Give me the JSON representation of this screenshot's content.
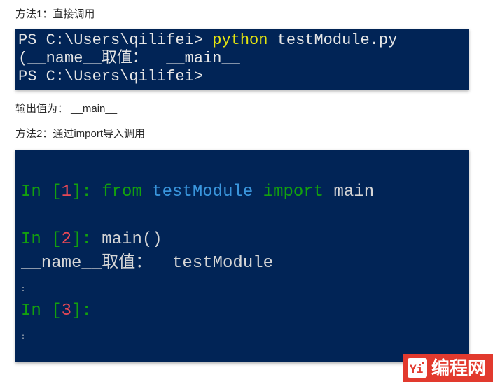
{
  "method1_title": "方法1：直接调用",
  "term1": {
    "line1_prompt": "PS C:\\Users\\qilifei> ",
    "line1_cmd": "python",
    "line1_arg": " testModule.py",
    "line2_pre": "(",
    "line2_label": "__name__取值：  ",
    "line2_value": "__main__",
    "line3_prompt": "PS C:\\Users\\qilifei>"
  },
  "output_label": "输出值为：  ",
  "output_value": "__main__",
  "method2_title": "方法2：通过import导入调用",
  "term2": {
    "in1_prefix": "In [",
    "in1_num": "1",
    "in1_suffix": "]: ",
    "in1_from": "from",
    "in1_module": " testModule ",
    "in1_import": "import",
    "in1_name": " main",
    "in2_prefix": "In [",
    "in2_num": "2",
    "in2_suffix": "]: ",
    "in2_call": "main()",
    "line_label": "__name__取值：  testModule",
    "in3_prefix": "In [",
    "in3_num": "3",
    "in3_suffix": "]:"
  },
  "logo_text": "编程网"
}
